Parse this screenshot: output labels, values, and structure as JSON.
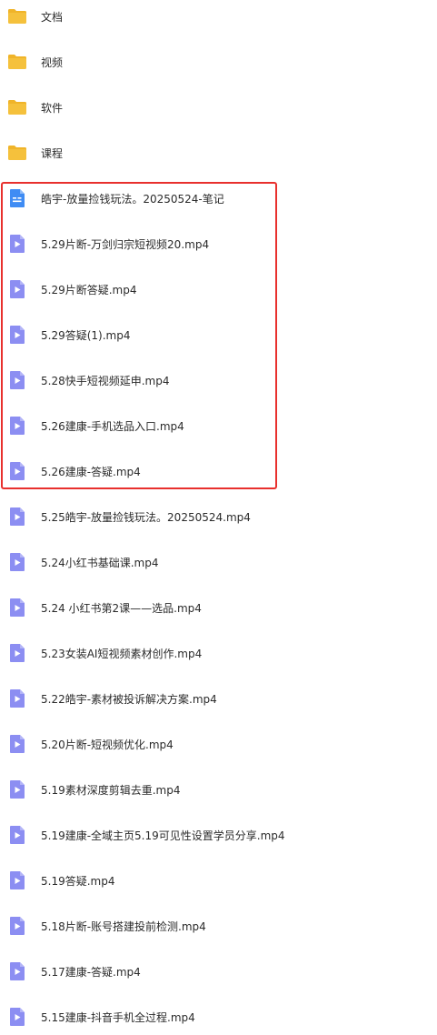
{
  "items": [
    {
      "name": "文档",
      "icon": "folder-icon",
      "type": "folder"
    },
    {
      "name": "视频",
      "icon": "folder-icon",
      "type": "folder"
    },
    {
      "name": "软件",
      "icon": "folder-icon",
      "type": "folder"
    },
    {
      "name": "课程",
      "icon": "folder-icon",
      "type": "folder"
    },
    {
      "name": "皓宇-放量捡钱玩法。20250524-笔记",
      "icon": "document-icon",
      "type": "doc"
    },
    {
      "name": "5.29片断-万剑归宗短视频20.mp4",
      "icon": "video-icon",
      "type": "video"
    },
    {
      "name": "5.29片断答疑.mp4",
      "icon": "video-icon",
      "type": "video"
    },
    {
      "name": "5.29答疑(1).mp4",
      "icon": "video-icon",
      "type": "video"
    },
    {
      "name": "5.28快手短视频延申.mp4",
      "icon": "video-icon",
      "type": "video"
    },
    {
      "name": "5.26建康-手机选品入口.mp4",
      "icon": "video-icon",
      "type": "video"
    },
    {
      "name": "5.26建康-答疑.mp4",
      "icon": "video-icon",
      "type": "video"
    },
    {
      "name": "5.25皓宇-放量捡钱玩法。20250524.mp4",
      "icon": "video-icon",
      "type": "video"
    },
    {
      "name": "5.24小红书基础课.mp4",
      "icon": "video-icon",
      "type": "video"
    },
    {
      "name": "5.24 小红书第2课——选品.mp4",
      "icon": "video-icon",
      "type": "video"
    },
    {
      "name": "5.23女装AI短视频素材创作.mp4",
      "icon": "video-icon",
      "type": "video"
    },
    {
      "name": "5.22皓宇-素材被投诉解决方案.mp4",
      "icon": "video-icon",
      "type": "video"
    },
    {
      "name": "5.20片断-短视频优化.mp4",
      "icon": "video-icon",
      "type": "video"
    },
    {
      "name": "5.19素材深度剪辑去重.mp4",
      "icon": "video-icon",
      "type": "video"
    },
    {
      "name": "5.19建康-全域主页5.19可见性设置学员分享.mp4",
      "icon": "video-icon",
      "type": "video"
    },
    {
      "name": "5.19答疑.mp4",
      "icon": "video-icon",
      "type": "video"
    },
    {
      "name": "5.18片断-账号搭建投前检测.mp4",
      "icon": "video-icon",
      "type": "video"
    },
    {
      "name": "5.17建康-答疑.mp4",
      "icon": "video-icon",
      "type": "video"
    },
    {
      "name": "5.15建康-抖音手机全过程.mp4",
      "icon": "video-icon",
      "type": "video"
    }
  ],
  "colors": {
    "folder": "#f5c13c",
    "folder_tab": "#f0b429",
    "video": "#8c8ef2",
    "video_play": "#ffffff",
    "doc": "#3f8cf4",
    "highlight": "#e8302d"
  }
}
